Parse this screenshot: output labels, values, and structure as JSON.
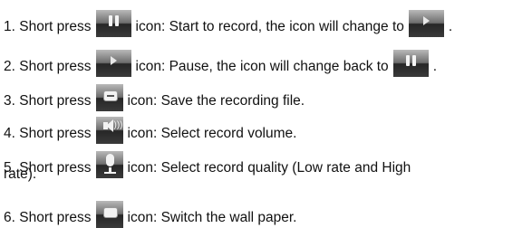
{
  "steps": [
    {
      "num": "1.",
      "prefix": "Short press",
      "text_a": "icon: Start to record, the icon will change to",
      "text_b": "."
    },
    {
      "num": "2.",
      "prefix": "Short press",
      "text_a": "icon: Pause, the icon will change back to",
      "text_b": "."
    },
    {
      "num": "3.",
      "prefix": "Short press",
      "text_a": "icon: Save the recording file."
    },
    {
      "num": "4.",
      "prefix": "Short press",
      "text_a": "icon: Select record volume."
    },
    {
      "num": "5.",
      "prefix": "Short press",
      "text_a": "icon: Select record quality (Low rate and High",
      "text_cont": "rate)."
    },
    {
      "num": "6.",
      "prefix": "Short press",
      "text_a": "icon: Switch the wall paper."
    }
  ],
  "icons": {
    "step1": "pause-icon",
    "step1_result": "play-icon",
    "step2": "play-icon",
    "step2_result": "pause-icon",
    "step3": "save-icon",
    "step4": "volume-icon",
    "step5": "microphone-icon",
    "step6": "wallpaper-icon"
  }
}
